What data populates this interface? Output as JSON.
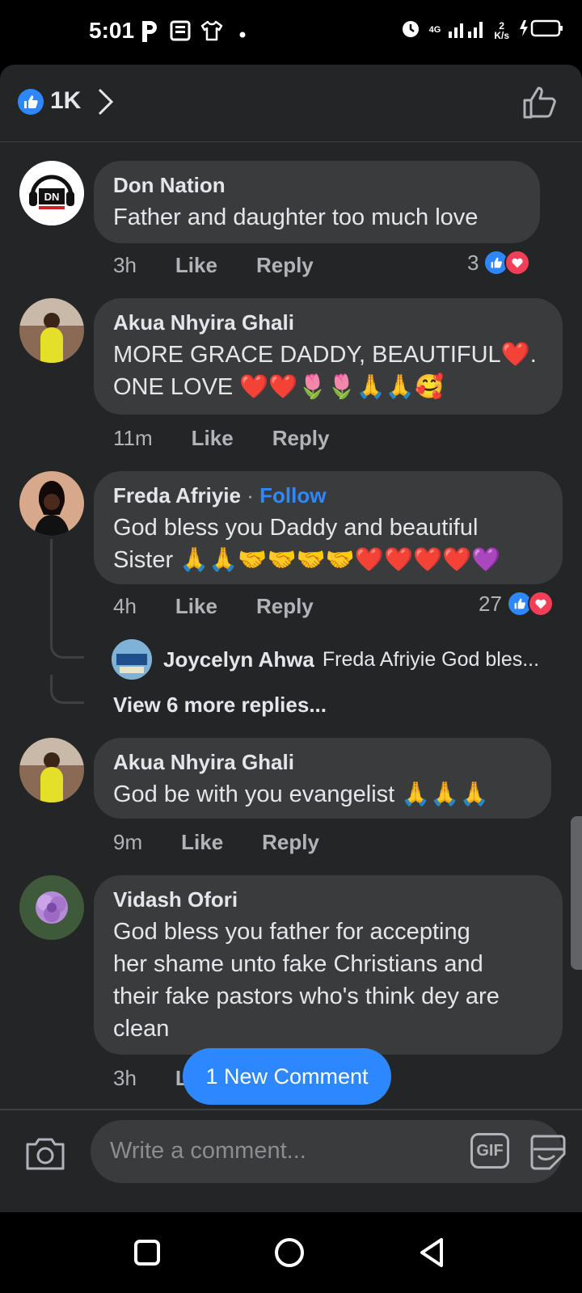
{
  "status_bar": {
    "time": "5:01",
    "network": "4G",
    "speed_value": "2",
    "speed_unit": "K/s"
  },
  "header": {
    "reaction_count": "1K"
  },
  "comments": [
    {
      "author": "Don Nation",
      "text": "Father and daughter too much love",
      "time": "3h",
      "like_label": "Like",
      "reply_label": "Reply",
      "reaction_count": "3"
    },
    {
      "author": "Akua Nhyira Ghali",
      "text_line1": "MORE GRACE DADDY, BEAUTIFUL❤️.",
      "text_line2": "ONE LOVE ❤️❤️🌷🌷🙏🙏🥰",
      "time": "11m",
      "like_label": "Like",
      "reply_label": "Reply"
    },
    {
      "author": "Freda Afriyie",
      "follow_label": "Follow",
      "text_line1": "God bless you Daddy and beautiful",
      "text_line2": "Sister 🙏🙏🤝🤝🤝🤝❤️❤️❤️❤️💜",
      "time": "4h",
      "like_label": "Like",
      "reply_label": "Reply",
      "reaction_count": "27",
      "reply_preview": {
        "author": "Joycelyn Ahwa",
        "text": "Freda Afriyie  God bles..."
      },
      "view_more_label": "View 6 more replies..."
    },
    {
      "author": "Akua Nhyira Ghali",
      "text": "God be with you evangelist 🙏🙏🙏",
      "time": "9m",
      "like_label": "Like",
      "reply_label": "Reply"
    },
    {
      "author": "Vidash Ofori",
      "text_line1": "God bless you father for accepting",
      "text_line2": "her shame unto fake Christians and",
      "text_line3": "their fake pastors who's think dey are",
      "text_line4": "clean",
      "time": "3h",
      "like_label": "Li"
    }
  ],
  "new_comment_button": "1 New Comment",
  "composer": {
    "placeholder": "Write a comment...",
    "gif_label": "GIF"
  },
  "colors": {
    "accent": "#2d88ff",
    "love": "#f33e58",
    "panel_bg": "#242526",
    "bubble_bg": "#3a3b3c"
  }
}
